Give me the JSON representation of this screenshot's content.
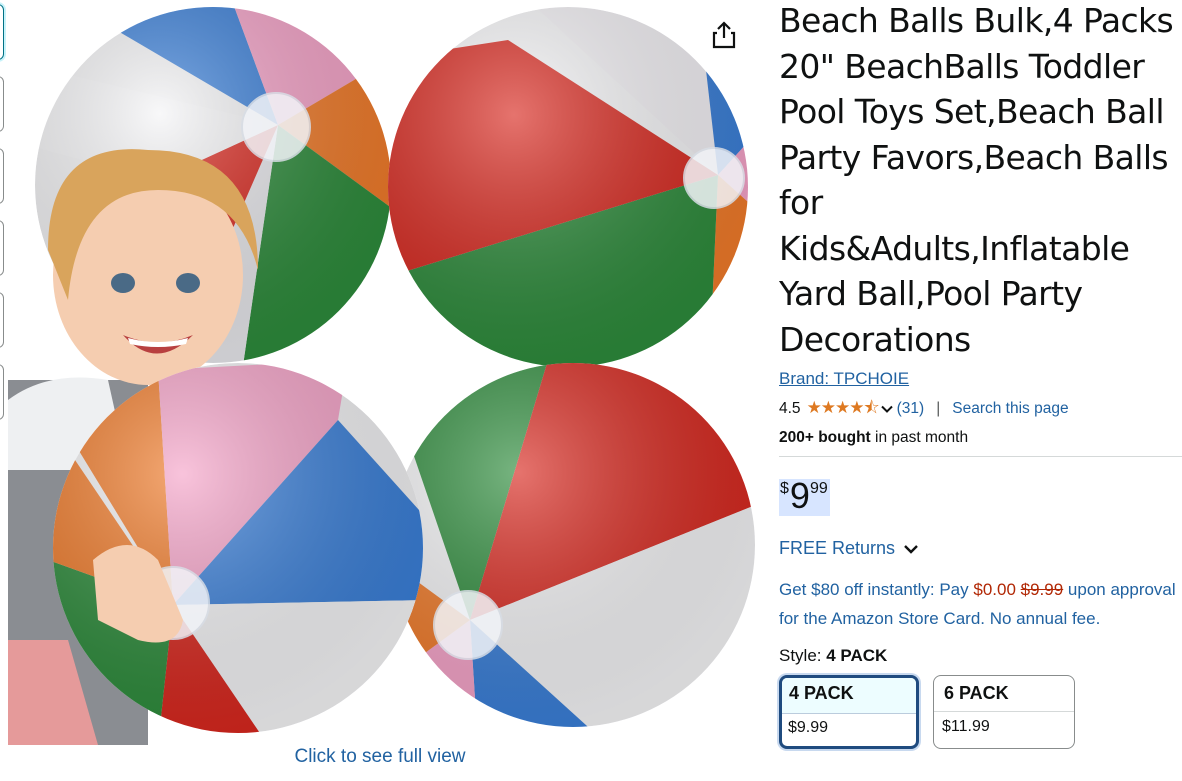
{
  "product": {
    "title": "Beach Balls Bulk,4 Packs 20\" BeachBalls Toddler Pool Toys Set,Beach Ball Party Favors,Beach Balls for Kids&Adults,Inflatable Yard Ball,Pool Party Decorations",
    "brand_link": "Brand: TPCHOIE",
    "rating": "4.5",
    "stars": "★★★★⯪",
    "rating_count": "(31)",
    "separator": "|",
    "search_link": "Search this page",
    "bought_bold": "200+ bought",
    "bought_rest": " in past month"
  },
  "price": {
    "symbol": "$",
    "whole": "9",
    "fraction": "99"
  },
  "returns": {
    "label": "FREE Returns"
  },
  "promo": {
    "part1": "Get $80 off instantly: Pay ",
    "pay_price": "$0.00",
    "strike_price": "$9.99",
    "part2": " upon approval for the Amazon Store Card. No annual fee."
  },
  "style": {
    "label": "Style: ",
    "selected": "4 PACK",
    "options": [
      {
        "name": "4 PACK",
        "price": "$9.99",
        "selected": true
      },
      {
        "name": "6 PACK",
        "price": "$11.99",
        "selected": false
      }
    ]
  },
  "image": {
    "full_view_link": "Click to see full view"
  },
  "icons": {
    "share": "share-icon",
    "chevron": "chevron-down-icon"
  },
  "colors": {
    "link": "#2162a1",
    "star": "#de7921",
    "deal_red": "#b12704",
    "price_highlight": "#d7e5ff",
    "selected_border": "#1f4b7f"
  }
}
